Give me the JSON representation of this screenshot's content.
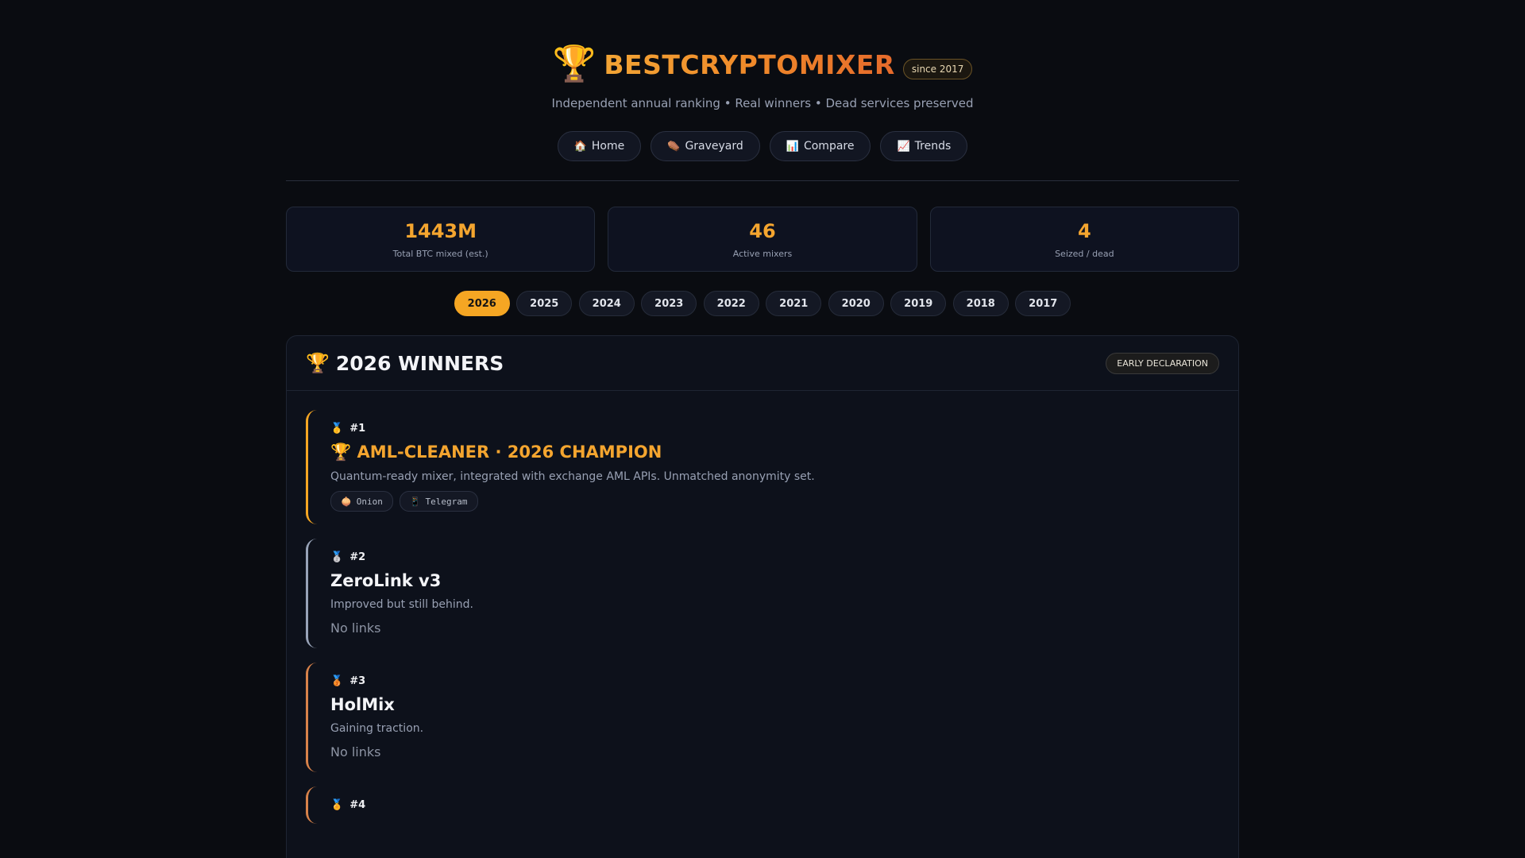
{
  "header": {
    "trophy_icon": "🏆",
    "brand": "BESTCRYPTOMIXER",
    "since": "since 2017",
    "tagline": "Independent annual ranking • Real winners • Dead services preserved"
  },
  "nav": [
    {
      "icon": "🏠",
      "icon_name": "home-icon",
      "label": "Home"
    },
    {
      "icon": "⚰️",
      "icon_name": "coffin-icon",
      "label": "Graveyard"
    },
    {
      "icon": "📊",
      "icon_name": "bar-chart-icon",
      "label": "Compare"
    },
    {
      "icon": "📈",
      "icon_name": "trend-chart-icon",
      "label": "Trends"
    }
  ],
  "stats": [
    {
      "value": "1443M",
      "label": "Total BTC mixed (est.)"
    },
    {
      "value": "46",
      "label": "Active mixers"
    },
    {
      "value": "4",
      "label": "Seized / dead"
    }
  ],
  "years": {
    "active": "2026",
    "items": [
      "2026",
      "2025",
      "2024",
      "2023",
      "2022",
      "2021",
      "2020",
      "2019",
      "2018",
      "2017"
    ]
  },
  "winners": {
    "title_icon": "🏆",
    "title": "2026 WINNERS",
    "badge": "EARLY DECLARATION",
    "entries": [
      {
        "medal": "🥇",
        "rank": "#1",
        "name": "🏆 AML-CLEANER · 2026 CHAMPION",
        "desc": "Quantum-ready mixer, integrated with exchange AML APIs. Unmatched anonymity set.",
        "links": [
          {
            "icon": "🧅",
            "label": "Onion"
          },
          {
            "icon": "📱",
            "label": "Telegram"
          }
        ]
      },
      {
        "medal": "🥈",
        "rank": "#2",
        "name": "ZeroLink v3",
        "desc": "Improved but still behind.",
        "no_links": "No links"
      },
      {
        "medal": "🥉",
        "rank": "#3",
        "name": "HolMix",
        "desc": "Gaining traction.",
        "no_links": "No links"
      },
      {
        "medal": "🏅",
        "rank": "#4"
      }
    ]
  },
  "colors": {
    "accent": "#f5a623",
    "background": "#0a0c11",
    "gold": "#f5a623",
    "silver": "#98a3b8",
    "bronze": "#d8824a"
  }
}
